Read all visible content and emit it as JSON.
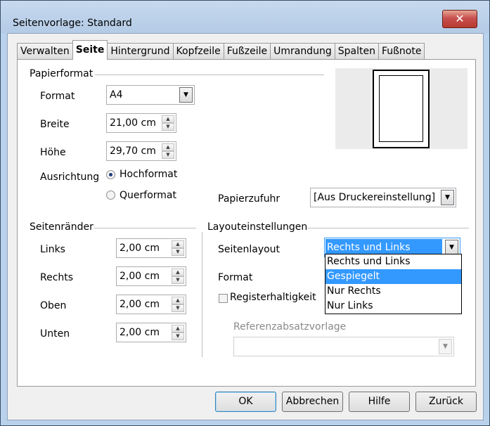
{
  "window": {
    "title": "Seitenvorlage: Standard",
    "close_glyph": "✕"
  },
  "tabs": [
    "Verwalten",
    "Seite",
    "Hintergrund",
    "Kopfzeile",
    "Fußzeile",
    "Umrandung",
    "Spalten",
    "Fußnote"
  ],
  "active_tab": "Seite",
  "paper": {
    "section_title": "Papierformat",
    "format_label": "Format",
    "format_value": "A4",
    "width_label": "Breite",
    "width_value": "21,00 cm",
    "height_label": "Höhe",
    "height_value": "29,70 cm",
    "orientation_label": "Ausrichtung",
    "portrait_label": "Hochformat",
    "landscape_label": "Querformat",
    "orientation_selected": "Hochformat",
    "tray_label": "Papierzufuhr",
    "tray_value": "[Aus Druckereinstellung]"
  },
  "margins": {
    "section_title": "Seitenränder",
    "left_label": "Links",
    "left_value": "2,00 cm",
    "right_label": "Rechts",
    "right_value": "2,00 cm",
    "top_label": "Oben",
    "top_value": "2,00 cm",
    "bottom_label": "Unten",
    "bottom_value": "2,00 cm"
  },
  "layout": {
    "section_title": "Layouteinstellungen",
    "page_layout_label": "Seitenlayout",
    "page_layout_value": "Rechts und Links",
    "page_layout_options": [
      "Rechts und Links",
      "Gespiegelt",
      "Nur Rechts",
      "Nur Links"
    ],
    "highlighted_option": "Gespiegelt",
    "format_label": "Format",
    "register_true_label": "Registerhaltigkeit",
    "register_true_checked": false,
    "reference_style_label": "Referenzabsatzvorlage",
    "reference_style_value": ""
  },
  "buttons": {
    "ok": "OK",
    "cancel": "Abbrechen",
    "help": "Hilfe",
    "back": "Zurück"
  },
  "icons": {
    "spin": "spin-arrows-icon",
    "dropdown": "chevron-down-icon"
  },
  "colors": {
    "selection": "#3399ff",
    "title_bar": "#b9d1ea",
    "close_button": "#c75050"
  }
}
